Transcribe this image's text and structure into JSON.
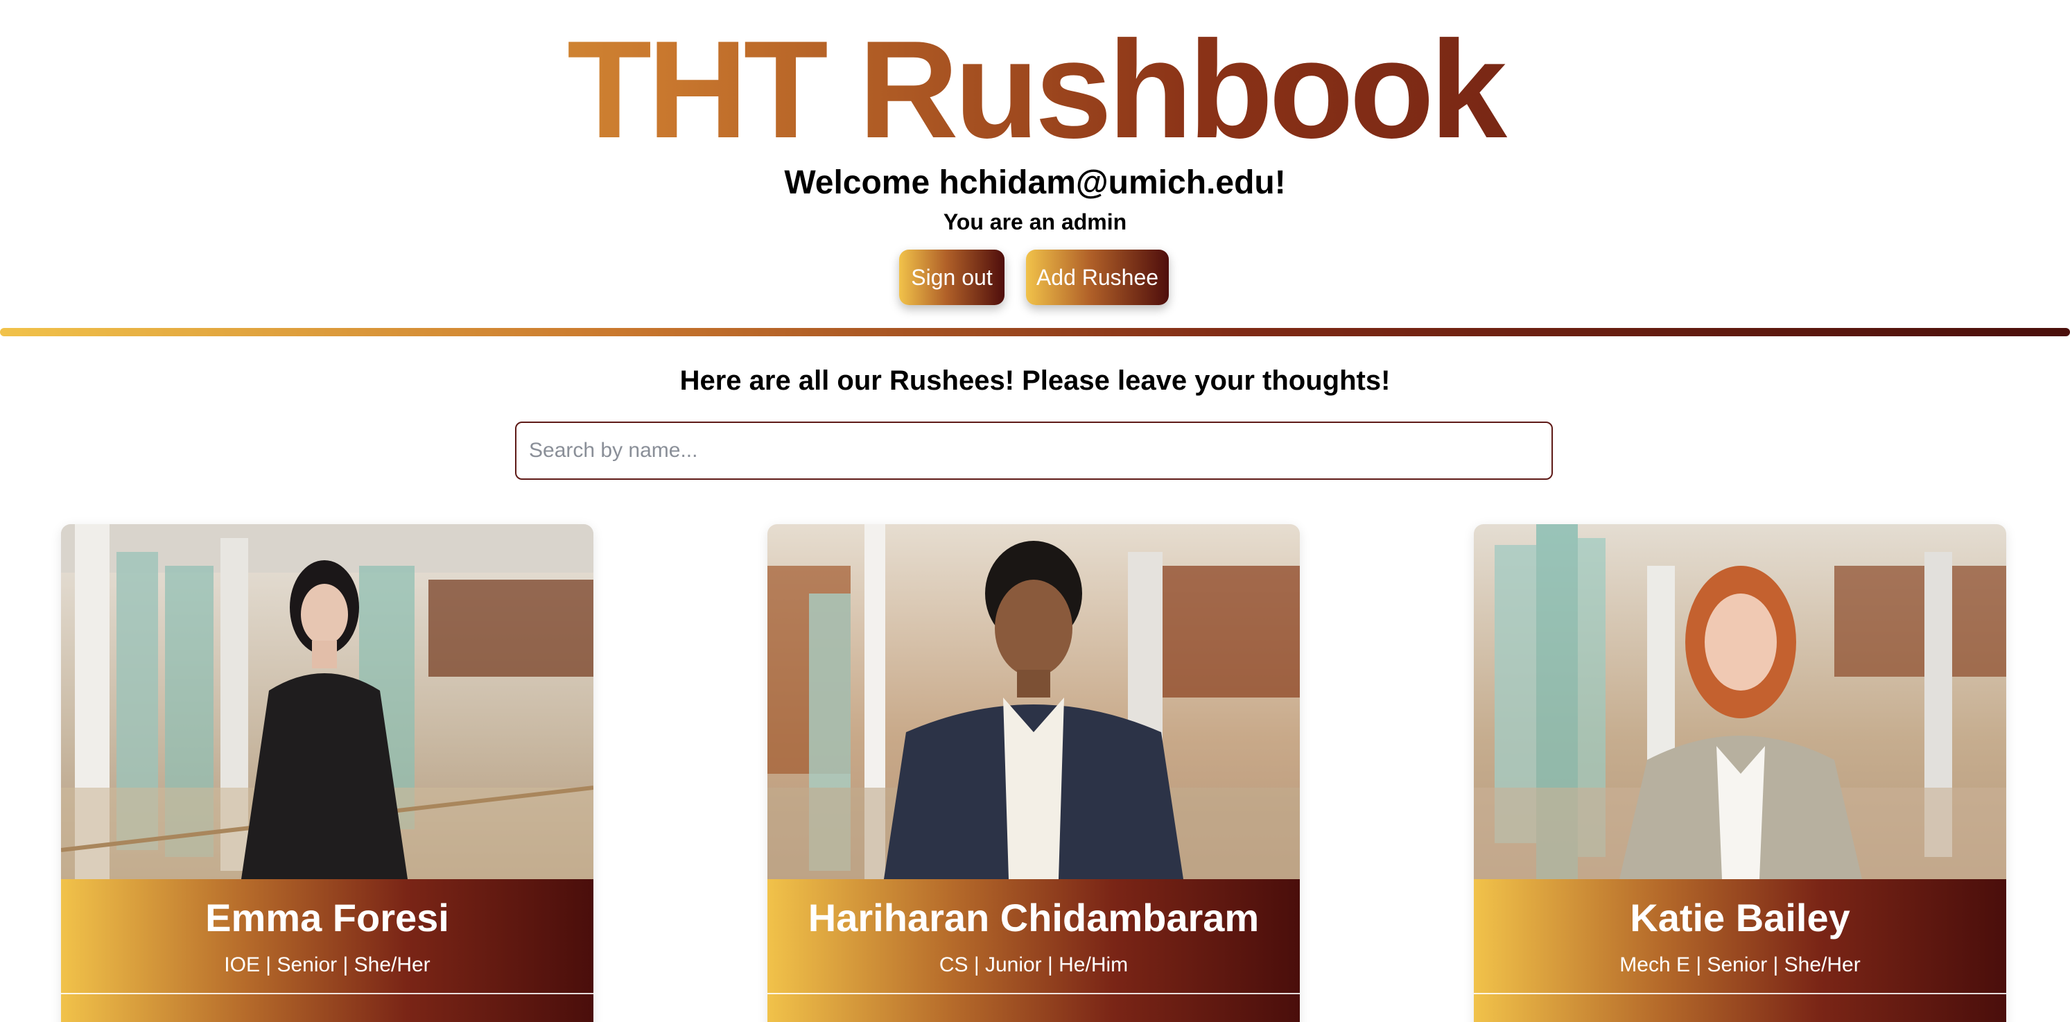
{
  "header": {
    "title_part1": "THT",
    "title_part2": "Rushbook",
    "welcome": "Welcome hchidam@umich.edu!",
    "role": "You are an admin",
    "sign_out_label": "Sign out",
    "add_rushee_label": "Add Rushee"
  },
  "main": {
    "heading": "Here are all our Rushees! Please leave your thoughts!",
    "search_placeholder": "Search by name..."
  },
  "rushees": [
    {
      "name": "Emma Foresi",
      "details": "IOE | Senior | She/Her"
    },
    {
      "name": "Hariharan Chidambaram",
      "details": "CS | Junior | He/Him"
    },
    {
      "name": "Katie Bailey",
      "details": "Mech E | Senior | She/Her"
    }
  ],
  "colors": {
    "gradient_start": "#f1c24a",
    "gradient_mid": "#b56a2a",
    "gradient_end": "#4a0e0b",
    "search_border": "#5e1a17"
  }
}
